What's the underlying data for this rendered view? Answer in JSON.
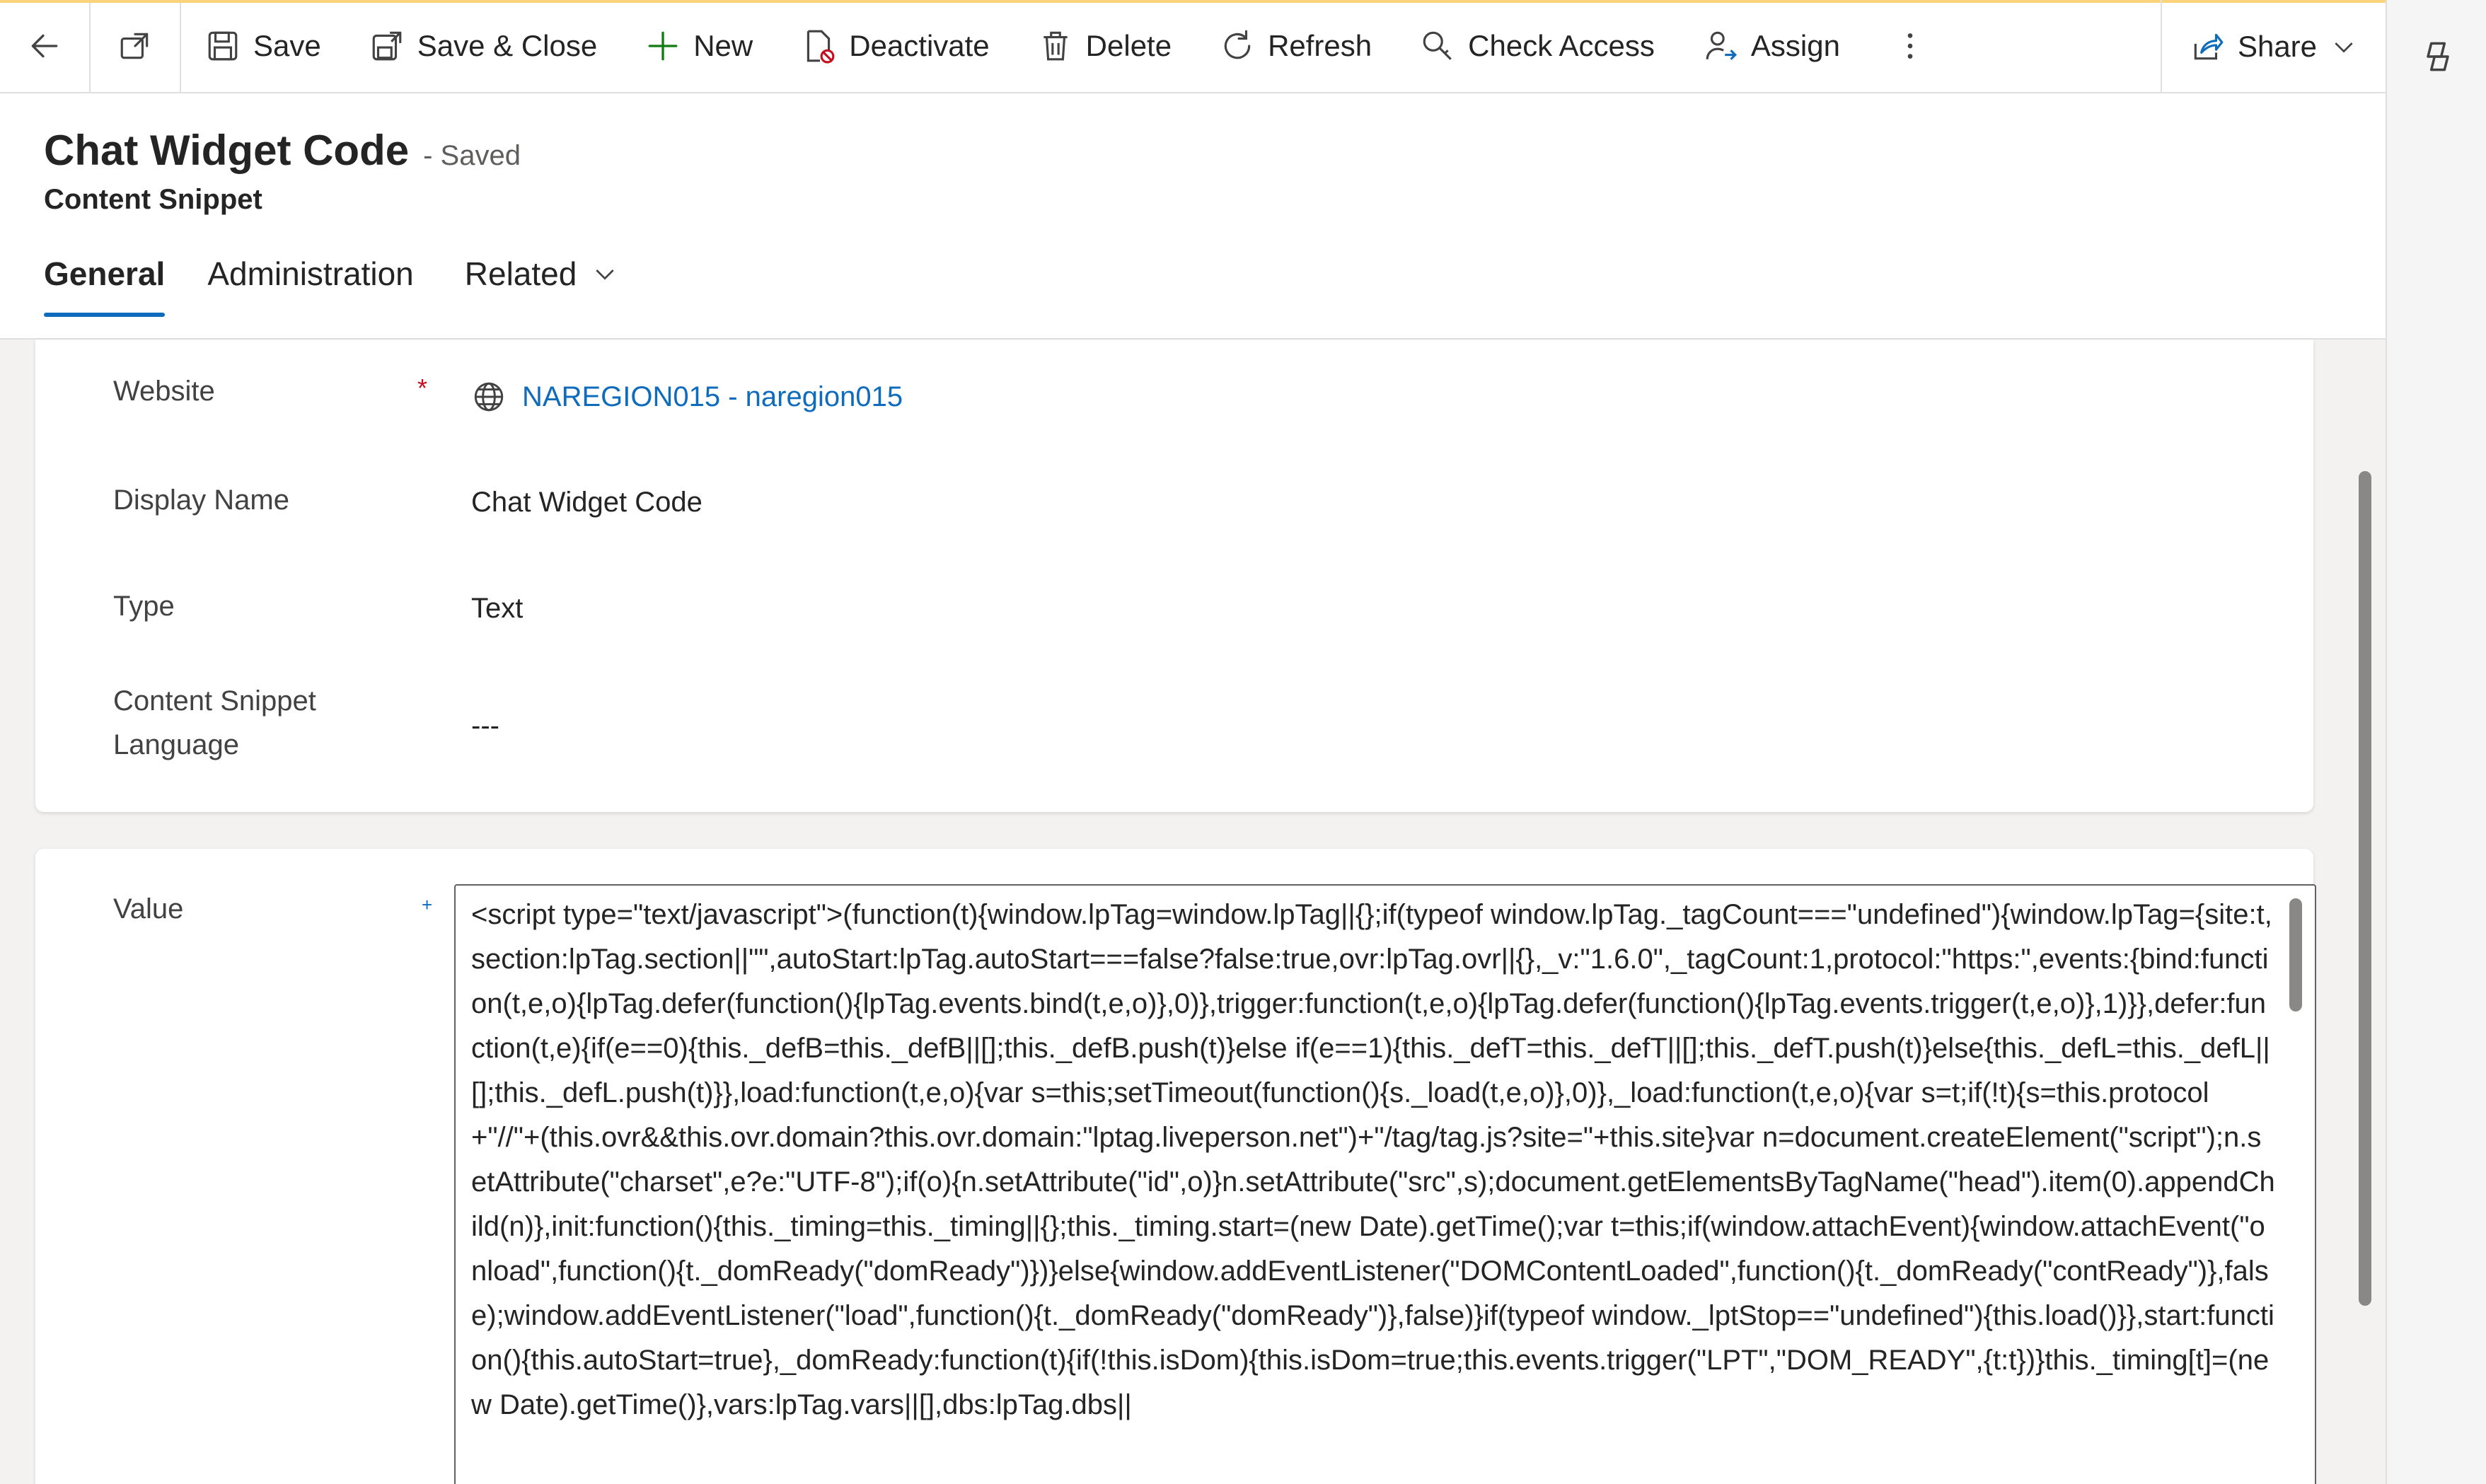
{
  "commandbar": {
    "save": "Save",
    "save_close": "Save & Close",
    "new": "New",
    "deactivate": "Deactivate",
    "delete": "Delete",
    "refresh": "Refresh",
    "check_access": "Check Access",
    "assign": "Assign",
    "share": "Share"
  },
  "header": {
    "title": "Chat Widget Code",
    "status": "- Saved",
    "entity": "Content Snippet",
    "tabs": [
      {
        "label": "General",
        "active": true
      },
      {
        "label": "Administration",
        "active": false
      },
      {
        "label": "Related",
        "active": false
      }
    ]
  },
  "fields": {
    "website_label": "Website",
    "website_value": "NAREGION015 - naregion015",
    "display_name_label": "Display Name",
    "display_name_value": "Chat Widget Code",
    "type_label": "Type",
    "type_value": "Text",
    "language_label_line1": "Content Snippet",
    "language_label_line2": "Language",
    "language_value": "---",
    "value_label": "Value",
    "value_text": "<script type=\"text/javascript\">(function(t){window.lpTag=window.lpTag||{};if(typeof window.lpTag._tagCount===\"undefined\"){window.lpTag={site:t,section:lpTag.section||\"\",autoStart:lpTag.autoStart===false?false:true,ovr:lpTag.ovr||{},_v:\"1.6.0\",_tagCount:1,protocol:\"https:\",events:{bind:function(t,e,o){lpTag.defer(function(){lpTag.events.bind(t,e,o)},0)},trigger:function(t,e,o){lpTag.defer(function(){lpTag.events.trigger(t,e,o)},1)}},defer:function(t,e){if(e==0){this._defB=this._defB||[];this._defB.push(t)}else if(e==1){this._defT=this._defT||[];this._defT.push(t)}else{this._defL=this._defL||[];this._defL.push(t)}},load:function(t,e,o){var s=this;setTimeout(function(){s._load(t,e,o)},0)},_load:function(t,e,o){var s=t;if(!t){s=this.protocol+\"//\"+(this.ovr&&this.ovr.domain?this.ovr.domain:\"lptag.liveperson.net\")+\"/tag/tag.js?site=\"+this.site}var n=document.createElement(\"script\");n.setAttribute(\"charset\",e?e:\"UTF-8\");if(o){n.setAttribute(\"id\",o)}n.setAttribute(\"src\",s);document.getElementsByTagName(\"head\").item(0).appendChild(n)},init:function(){this._timing=this._timing||{};this._timing.start=(new Date).getTime();var t=this;if(window.attachEvent){window.attachEvent(\"onload\",function(){t._domReady(\"domReady\")})}else{window.addEventListener(\"DOMContentLoaded\",function(){t._domReady(\"contReady\")},false);window.addEventListener(\"load\",function(){t._domReady(\"domReady\")},false)}if(typeof window._lptStop==\"undefined\"){this.load()}},start:function(){this.autoStart=true},_domReady:function(t){if(!this.isDom){this.isDom=true;this.events.trigger(\"LPT\",\"DOM_READY\",{t:t})}this._timing[t]=(new Date).getTime()},vars:lpTag.vars||[],dbs:lpTag.dbs||"
  }
}
